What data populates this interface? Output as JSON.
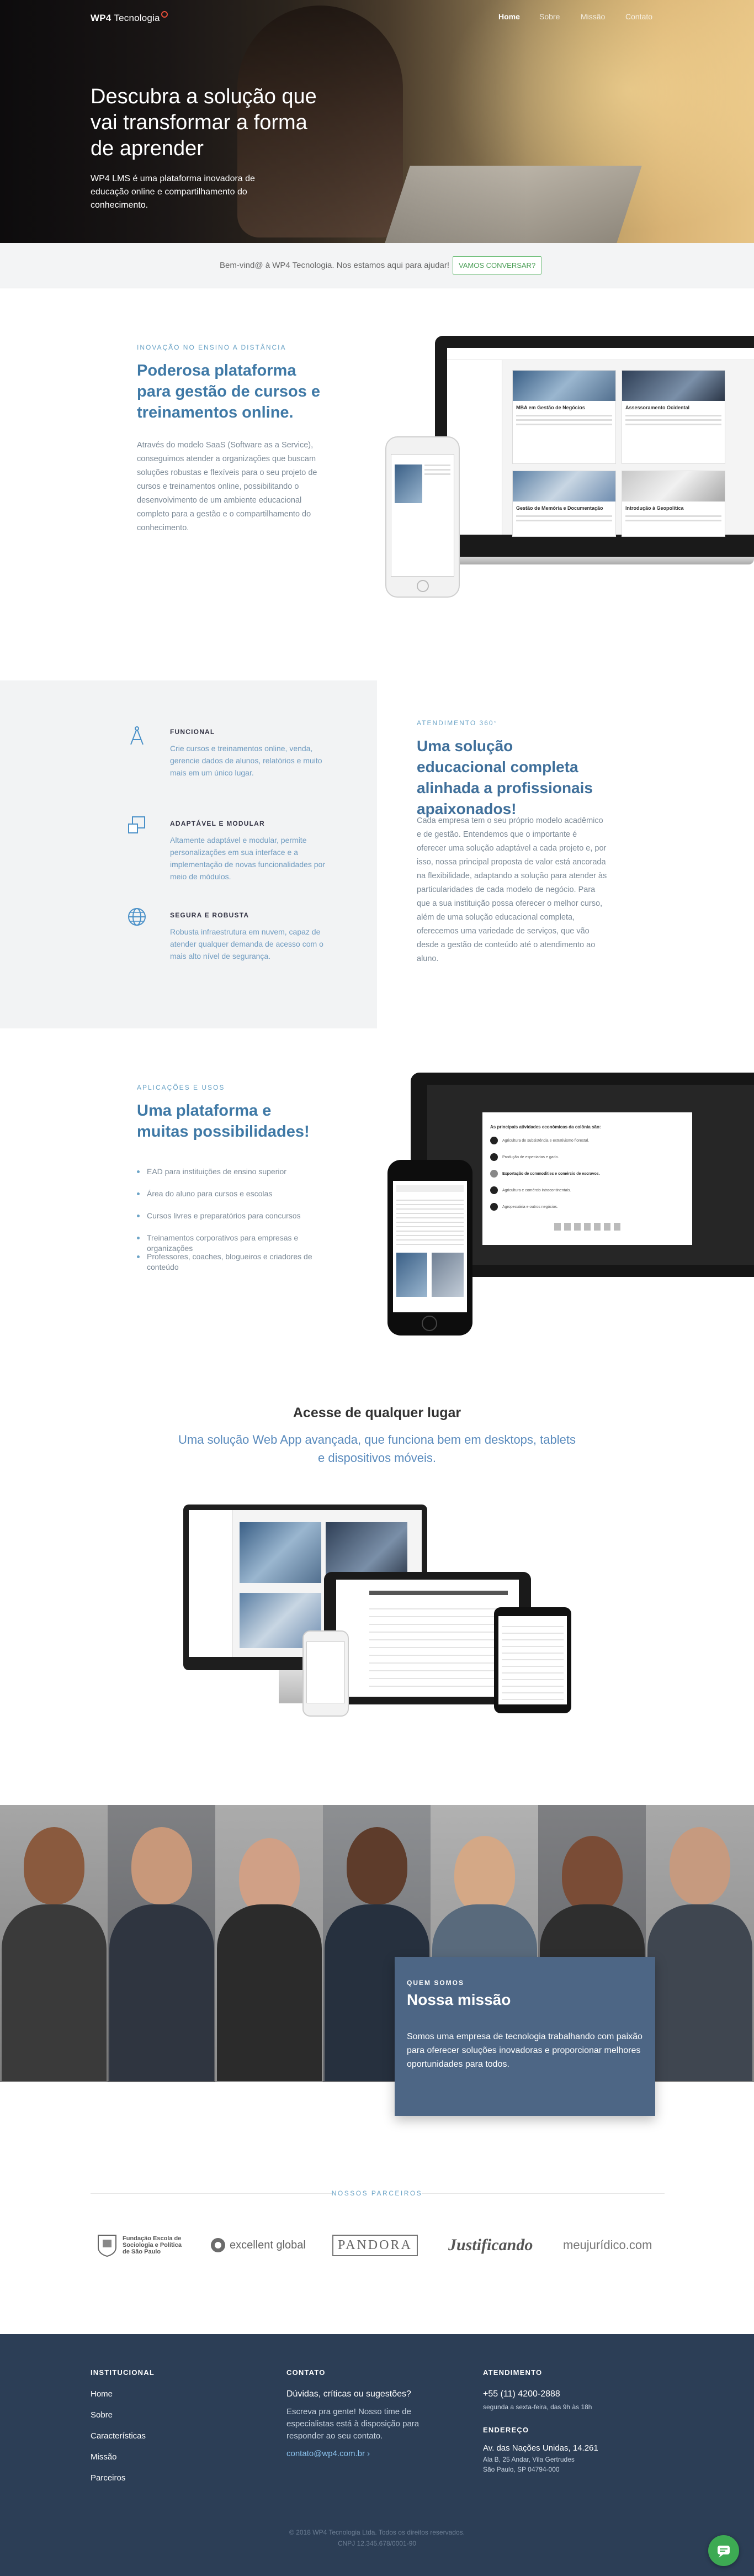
{
  "nav": {
    "brand_bold": "WP4",
    "brand_light": "Tecnologia",
    "links": [
      "Home",
      "Sobre",
      "Missão",
      "Contato"
    ]
  },
  "hero": {
    "title": "Descubra a solução que vai transformar a forma de aprender",
    "text": "WP4 LMS é uma plataforma inovadora de educação online e compartilhamento do conhecimento."
  },
  "banner": {
    "text": "Bem-vind@ à WP4 Tecnologia. Nos estamos aqui para ajudar!",
    "button": "VAMOS CONVERSAR?"
  },
  "platform": {
    "eyebrow": "INOVAÇÃO NO ENSINO A DISTÂNCIA",
    "title": "Poderosa plataforma para gestão de cursos e treinamentos online.",
    "text": "Através do modelo SaaS (Software as a Service), conseguimos atender a organizações que buscam soluções robustas e flexíveis para o seu projeto de cursos e treinamentos online, possibilitando o desenvolvimento de um ambiente educacional completo para a gestão e o compartilhamento do conhecimento.",
    "mock_cards": [
      "MBA em Gestão de Negócios",
      "Assessoramento Ocidental",
      "Gestão de Memória e Documentação",
      "Introdução à Geopolítica"
    ]
  },
  "features": [
    {
      "title": "FUNCIONAL",
      "text": "Crie cursos e treinamentos online, venda, gerencie dados de alunos, relatórios e muito mais em um único lugar.",
      "icon": "compass-icon"
    },
    {
      "title": "ADAPTÁVEL E MODULAR",
      "text": "Altamente adaptável e modular, permite personalizações em sua interface e a implementação de novas funcionalidades por meio de módulos.",
      "icon": "modules-icon"
    },
    {
      "title": "SEGURA E ROBUSTA",
      "text": "Robusta infraestrutura em nuvem, capaz de atender qualquer demanda de acesso com o mais alto nível de segurança.",
      "icon": "globe-icon"
    }
  ],
  "service": {
    "eyebrow": "ATENDIMENTO 360°",
    "title": "Uma solução educacional completa alinhada a profissionais apaixonados!",
    "text": "Cada empresa tem o seu próprio modelo acadêmico e de gestão. Entendemos que o importante é oferecer uma solução adaptável a cada projeto e, por isso, nossa principal proposta de valor está ancorada na flexibilidade, adaptando a solução para atender às particularidades de cada modelo de negócio. Para que a sua instituição possa oferecer o melhor curso, além de uma solução educacional completa, oferecemos uma variedade de serviços, que vão desde a gestão de conteúdo até o atendimento ao aluno."
  },
  "uses": {
    "eyebrow": "APLICAÇÕES E USOS",
    "title": "Uma plataforma e muitas possibilidades!",
    "items": [
      "EAD para instituições de ensino superior",
      "Área do aluno para cursos e escolas",
      "Cursos livres e preparatórios para concursos",
      "Treinamentos corporativos para empresas e organizações",
      "Professores, coaches, blogueiros e criadores de conteúdo"
    ],
    "quiz_question": "As principais atividades econômicas da colônia são:",
    "quiz_options": [
      "Agricultura de subsistência e extrativismo florestal.",
      "Produção de especiarias e gado.",
      "Exportação de commodities e comércio de escravos.",
      "Agricultura e comércio intracontinentais.",
      "Agropecuária e outros negócios."
    ]
  },
  "anywhere": {
    "title": "Acesse de qualquer lugar",
    "subtitle": "Uma solução Web App avançada, que funciona bem em desktops, tablets e dispositivos móveis."
  },
  "mission": {
    "eyebrow": "QUEM SOMOS",
    "title": "Nossa missão",
    "text": "Somos uma empresa de tecnologia trabalhando com paixão para oferecer soluções inovadoras e proporcionar melhores oportunidades para todos."
  },
  "partners": {
    "title": "NOSSOS PARCEIROS",
    "logos": [
      {
        "name": "Fundação Escola de Sociologia e Política de São Paulo",
        "icon": "fespsp-logo"
      },
      {
        "name": "excellent global",
        "icon": "excellent-global-logo"
      },
      {
        "name": "PANDORA",
        "icon": "pandora-logo"
      },
      {
        "name": "Justificando",
        "icon": "justificando-logo"
      },
      {
        "name": "meujurídico.com",
        "icon": "meujuridico-logo"
      }
    ]
  },
  "footer": {
    "institutional": {
      "title": "INSTITUCIONAL",
      "links": [
        "Home",
        "Sobre",
        "Características",
        "Missão",
        "Parceiros"
      ]
    },
    "contact": {
      "title": "CONTATO",
      "question": "Dúvidas, críticas ou sugestões?",
      "text": "Escreva pra gente! Nosso time de especialistas está à disposição para responder ao seu contato.",
      "email": "contato@wp4.com.br"
    },
    "service": {
      "title": "ATENDIMENTO",
      "phone": "+55 (11) 4200-2888",
      "hours": "segunda a sexta-feira, das 9h às 18h"
    },
    "address": {
      "title": "ENDEREÇO",
      "line1": "Av. das Nações Unidas, 14.261",
      "line2": "Ala B, 25 Andar, Vila Gertrudes",
      "line3": "São Paulo, SP 04794-000"
    },
    "copyright": "© 2018 WP4 Tecnologia Ltda. Todos os direitos reservados.",
    "cnpj": "CNPJ 12.345.678/0001-90"
  },
  "colors": {
    "accent_blue": "#3f79a6",
    "eyebrow_blue": "#6aa3c6",
    "banner_green": "#69bd74",
    "footer_bg": "#2c3e56",
    "mission_bg": "#4d6685",
    "chat_green": "#3daa53"
  }
}
